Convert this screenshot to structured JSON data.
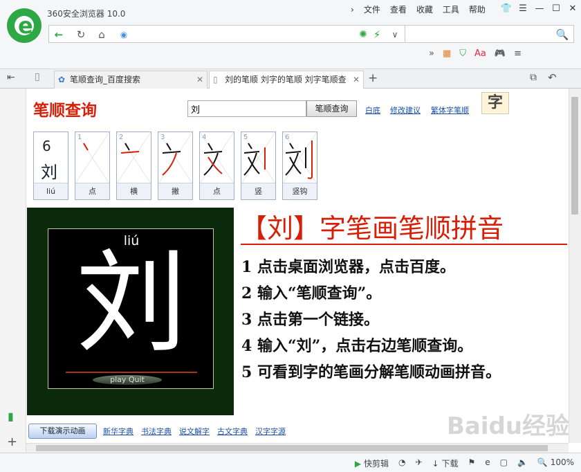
{
  "window": {
    "title": "360安全浏览器 10.0",
    "menu": [
      "文件",
      "查看",
      "收藏",
      "工具",
      "帮助"
    ]
  },
  "tabs": [
    {
      "label": "笔顺查询_百度搜索"
    },
    {
      "label": "刘的笔顺 刘字的笔顺 刘字笔顺查"
    }
  ],
  "page": {
    "brand": "笔顺查询",
    "query": "刘",
    "query_button": "笔顺查询",
    "links": [
      "白底",
      "修改建议",
      "繁体字笔顺"
    ],
    "zi_icon": "字",
    "summary": {
      "count": "6",
      "char": "刘",
      "pinyin": "liú"
    },
    "strokes": [
      {
        "n": "1",
        "name": "点"
      },
      {
        "n": "2",
        "name": "横"
      },
      {
        "n": "3",
        "name": "撇"
      },
      {
        "n": "4",
        "name": "点"
      },
      {
        "n": "5",
        "name": "竖"
      },
      {
        "n": "6",
        "name": "竖钩"
      }
    ],
    "animation": {
      "pinyin": "liú",
      "char": "刘",
      "play": "play",
      "quit": "Quit"
    },
    "title": "【刘】字笔画笔顺拼音",
    "steps": [
      "1 点击桌面浏览器，点击百度。",
      "2 输入“笔顺查询”。",
      "3 点击第一个链接。",
      "4 输入“刘”，点击右边笔顺查询。",
      "5 可看到字的笔画分解笔顺动画拼音。"
    ],
    "download_button": "下载演示动画",
    "bottom_links": [
      "新华字典",
      "书法字典",
      "说文解字",
      "古文字典",
      "汉字字源"
    ]
  },
  "status": {
    "items": [
      "快剪辑",
      "下载"
    ],
    "zoom": "100%"
  },
  "watermark": "Baidu经验"
}
